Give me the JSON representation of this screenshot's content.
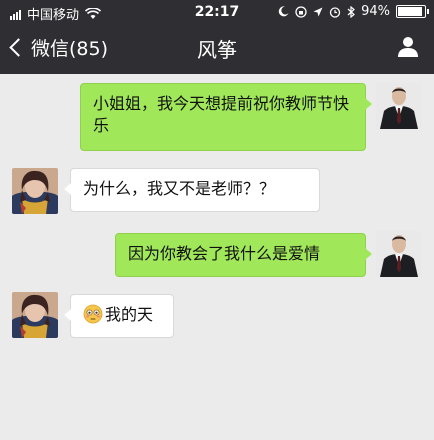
{
  "status_bar": {
    "carrier": "中国移动",
    "time": "22:17",
    "battery": "94%"
  },
  "header": {
    "back_label": "微信(85)",
    "title": "风筝"
  },
  "messages": [
    {
      "sender": "me",
      "text": "小姐姐，我今天想提前祝你教师节快乐"
    },
    {
      "sender": "them",
      "text": "为什么，我又不是老师？？"
    },
    {
      "sender": "me",
      "text": "因为你教会了我什么是爱情"
    },
    {
      "sender": "them",
      "emoji": "flushed-face",
      "text": "我的天"
    }
  ],
  "colors": {
    "header_bg": "#2e2e33",
    "chat_bg": "#ebebeb",
    "my_bubble": "#a0e75a",
    "their_bubble": "#ffffff"
  }
}
